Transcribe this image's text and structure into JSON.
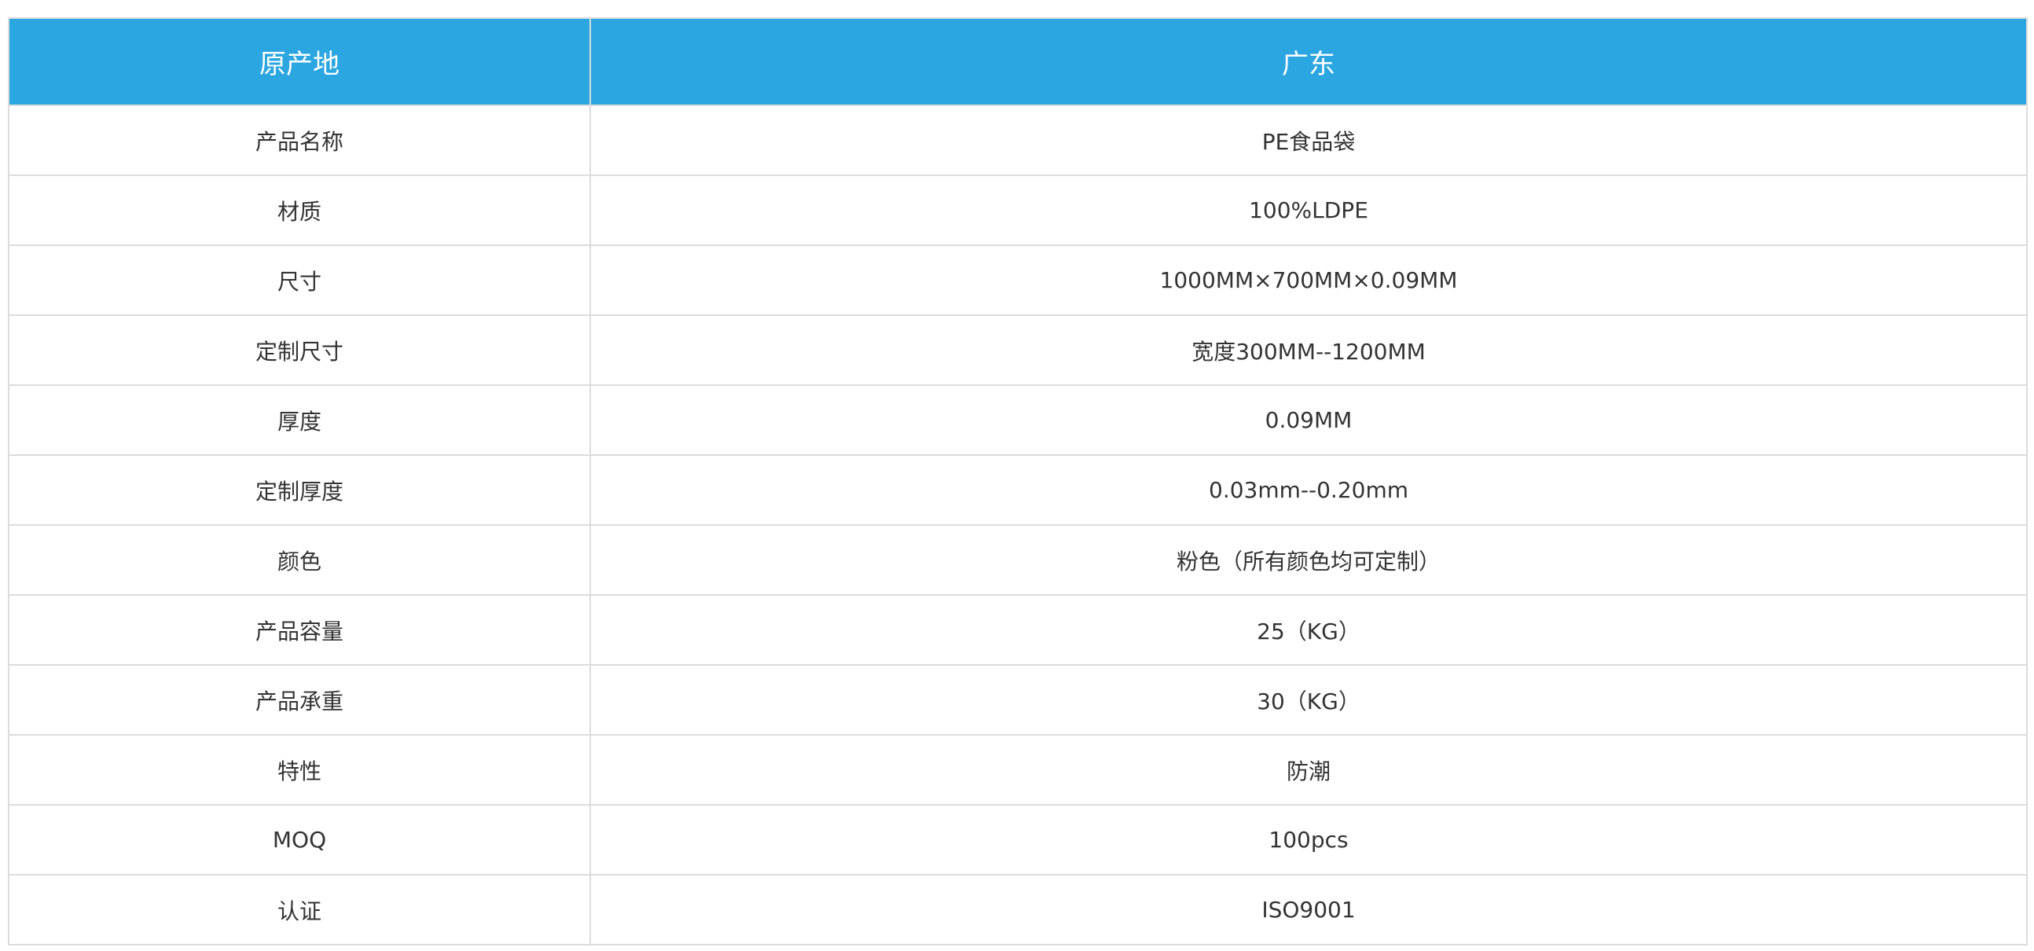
{
  "table": {
    "header": {
      "label": "原产地",
      "value": "广东"
    },
    "rows": [
      {
        "label": "产品名称",
        "value": "PE食品袋"
      },
      {
        "label": "材质",
        "value": "100%LDPE"
      },
      {
        "label": "尺寸",
        "value": "1000MM×700MM×0.09MM"
      },
      {
        "label": "定制尺寸",
        "value": "宽度300MM--1200MM"
      },
      {
        "label": "厚度",
        "value": "0.09MM"
      },
      {
        "label": "定制厚度",
        "value": "0.03mm--0.20mm"
      },
      {
        "label": "颜色",
        "value": "粉色（所有颜色均可定制）"
      },
      {
        "label": "产品容量",
        "value": "25（KG）"
      },
      {
        "label": "产品承重",
        "value": "30（KG）"
      },
      {
        "label": "特性",
        "value": "防潮"
      },
      {
        "label": "MOQ",
        "value": "100pcs"
      },
      {
        "label": "认证",
        "value": "ISO9001"
      }
    ]
  },
  "colors": {
    "header_bg": "#2ba6e1",
    "header_text": "#ffffff",
    "border": "#dcdcdc",
    "body_text": "#333333"
  }
}
